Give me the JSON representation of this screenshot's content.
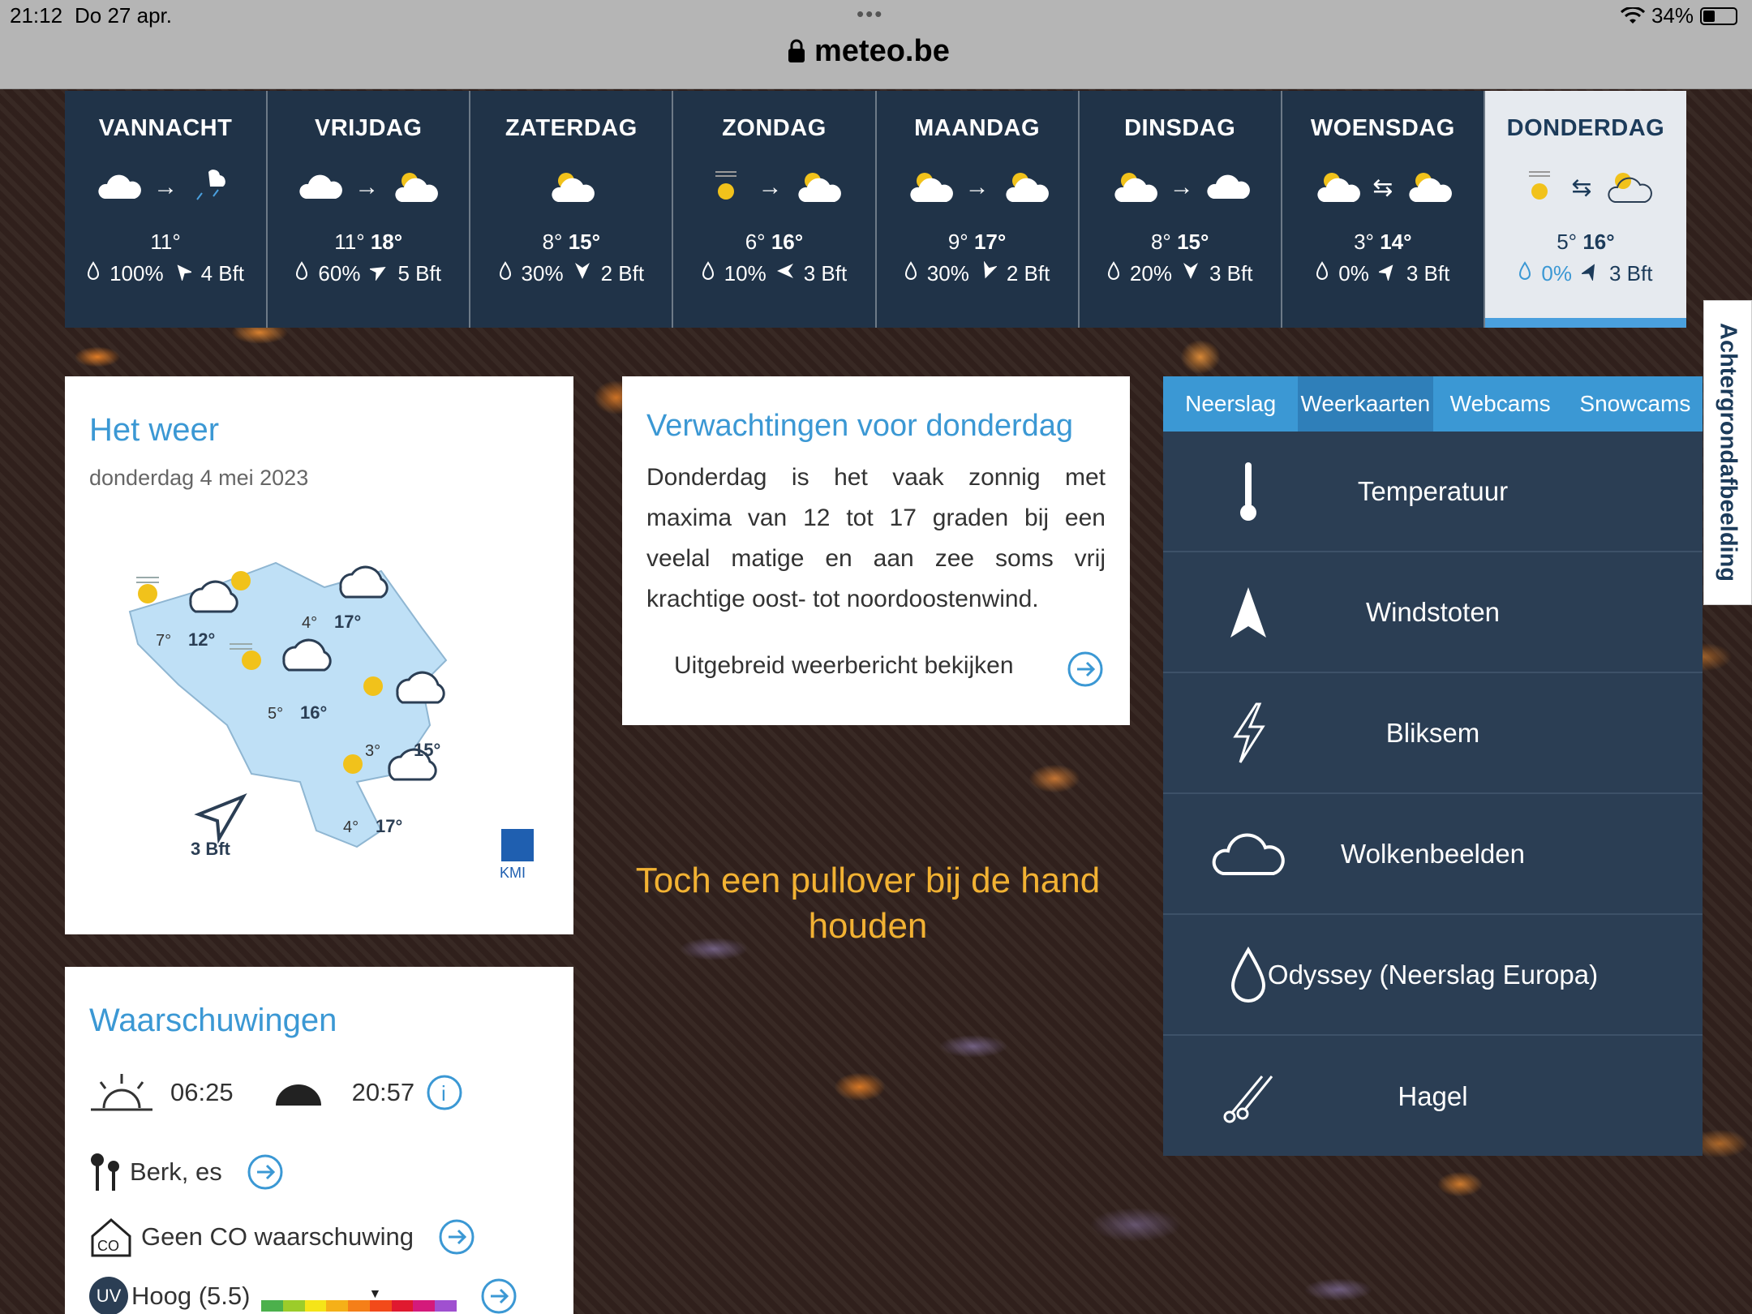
{
  "status": {
    "time": "21:12",
    "date": "Do 27 apr.",
    "url": "meteo.be",
    "battery": "34%"
  },
  "forecast": [
    {
      "name": "VANNACHT",
      "min": "11°",
      "max": "",
      "rain": "100%",
      "wind": "4 Bft"
    },
    {
      "name": "VRIJDAG",
      "min": "11°",
      "max": "18°",
      "rain": "60%",
      "wind": "5 Bft"
    },
    {
      "name": "ZATERDAG",
      "min": "8°",
      "max": "15°",
      "rain": "30%",
      "wind": "2 Bft"
    },
    {
      "name": "ZONDAG",
      "min": "6°",
      "max": "16°",
      "rain": "10%",
      "wind": "3 Bft"
    },
    {
      "name": "MAANDAG",
      "min": "9°",
      "max": "17°",
      "rain": "30%",
      "wind": "2 Bft"
    },
    {
      "name": "DINSDAG",
      "min": "8°",
      "max": "15°",
      "rain": "20%",
      "wind": "3 Bft"
    },
    {
      "name": "WOENSDAG",
      "min": "3°",
      "max": "14°",
      "rain": "0%",
      "wind": "3 Bft"
    },
    {
      "name": "DONDERDAG",
      "min": "5°",
      "max": "16°",
      "rain": "0%",
      "wind": "3 Bft"
    }
  ],
  "hetweer": {
    "title": "Het weer",
    "date": "donderdag 4 mei 2023",
    "map": {
      "t1": "7°",
      "t2": "12°",
      "t3": "4°",
      "t4": "17°",
      "t5": "5°",
      "t6": "16°",
      "t7": "3°",
      "t8": "15°",
      "t9": "4°",
      "t10": "17°",
      "wind": "3 Bft",
      "logo": "KMI"
    }
  },
  "verwachting": {
    "title": "Verwachtingen voor donderdag",
    "text": "Donderdag is het vaak zonnig met maxima van 12 tot 17 graden bij een veelal matige en aan zee soms vrij krachtige oost- tot noordoostenwind.",
    "more": "Uitgebreid weerbericht bekijken"
  },
  "quote": "Toch een pullover bij de hand houden",
  "waarschuwingen": {
    "title": "Waarschuwingen",
    "sunrise": "06:25",
    "sunset": "20:57",
    "pollen": "Berk, es",
    "co": "Geen CO waarschuwing",
    "uv_label": "UV",
    "uv": "Hoog (5.5)",
    "uv_level": 0.55
  },
  "tabs": [
    "Neerslag",
    "Weerkaarten",
    "Webcams",
    "Snowcams"
  ],
  "menu": [
    "Temperatuur",
    "Windstoten",
    "Bliksem",
    "Wolkenbeelden",
    "Odyssey (Neerslag Europa)",
    "Hagel"
  ],
  "side_tab": "Achtergrondafbeelding",
  "colors": {
    "accent": "#3b98d4",
    "navy": "#2b3e54",
    "sun": "#f1c21b"
  }
}
